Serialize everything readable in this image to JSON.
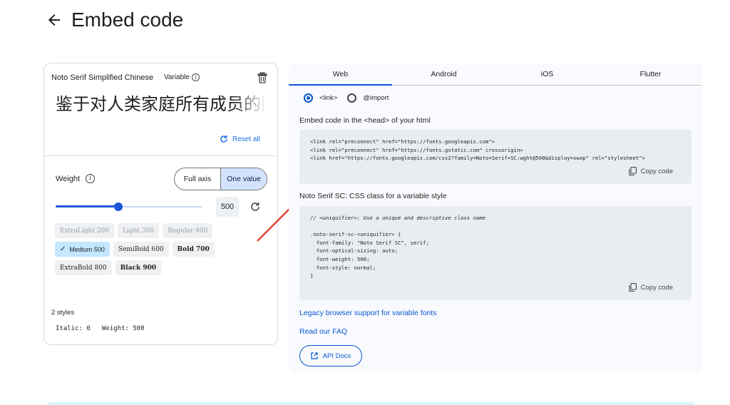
{
  "header": {
    "title": "Embed code",
    "back_icon": "arrow-left-icon"
  },
  "left_card": {
    "font_name": "Noto Serif Simplified Chinese",
    "variable_label": "Variable",
    "info_glyph": "i",
    "preview_text": "鉴于对人类家庭所有成员的固有尊严及其平等的和不移的权利的承认",
    "reset_all": "Reset all",
    "weight_label": "Weight",
    "axis_toggle": {
      "full_axis": "Full axis",
      "one_value": "One value",
      "selected": "One value"
    },
    "weight": {
      "min": 200,
      "max": 900,
      "value": 500,
      "value_text": "500"
    },
    "weight_chips": [
      [
        {
          "label": "ExtraLight 200",
          "state": "disabled"
        },
        {
          "label": "Light 300",
          "state": "disabled"
        },
        {
          "label": "Regular 400",
          "state": "disabled"
        }
      ],
      [
        {
          "label": "Medium 500",
          "state": "selected",
          "check": "✓"
        },
        {
          "label": "SemiBold 600",
          "state": "normal"
        },
        {
          "label": "Bold 700",
          "state": "bold"
        }
      ],
      [
        {
          "label": "ExtraBold 800",
          "state": "normal"
        },
        {
          "label": "Black 900",
          "state": "bold"
        }
      ]
    ],
    "styles_count": "2 styles",
    "styles_values": "Italic: 0   Weight: 500"
  },
  "right_panel": {
    "tabs": [
      "Web",
      "Android",
      "iOS",
      "Flutter"
    ],
    "active_tab": "Web",
    "radio_options": [
      {
        "label": "<link>",
        "checked": true
      },
      {
        "label": "@import",
        "checked": false
      }
    ],
    "head_label": "Embed code in the <head> of your html",
    "head_code": [
      "<link rel=\"preconnect\" href=\"https://fonts.googleapis.com\">",
      "<link rel=\"preconnect\" href=\"https://fonts.gstatic.com\" crossorigin>",
      "<link href=\"https://fonts.googleapis.com/css2?family=Noto+Serif+SC:wght@500&display=swap\" rel=\"stylesheet\">"
    ],
    "copy_label": "Copy code",
    "css_label": "Noto Serif SC: CSS class for a variable style",
    "css_code": [
      "// <uniquifier>: Use a unique and descriptive class name",
      "",
      ".noto-serif-sc-<uniquifier> {",
      "  font-family: \"Noto Serif SC\", serif;",
      "  font-optical-sizing: auto;",
      "  font-weight: 500;",
      "  font-style: normal;",
      "}"
    ],
    "legacy_link": "Legacy browser support for variable fonts",
    "faq_link": "Read our FAQ",
    "api_docs": "API Docs"
  },
  "colors": {
    "accent": "#0b57d0",
    "annotation": "#e8412c",
    "chip_selected": "#c2e7ff",
    "panel_bg": "#f8fafd"
  }
}
